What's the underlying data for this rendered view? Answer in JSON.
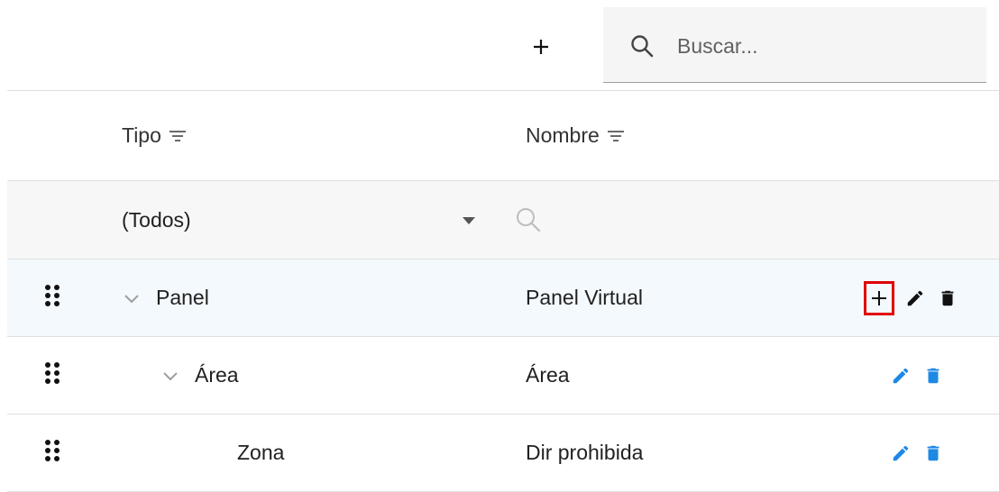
{
  "toolbar": {
    "add_label": "+",
    "search_placeholder": "Buscar..."
  },
  "grid": {
    "columns": [
      {
        "label": "Tipo"
      },
      {
        "label": "Nombre"
      }
    ],
    "filter": {
      "tipo_selected": "(Todos)"
    },
    "rows": [
      {
        "tipo": "Panel",
        "nombre": "Panel Virtual",
        "level": 0,
        "expanded": true
      },
      {
        "tipo": "Área",
        "nombre": "Área",
        "level": 1,
        "expanded": true
      },
      {
        "tipo": "Zona",
        "nombre": "Dir prohibida",
        "level": 2,
        "expanded": false
      }
    ]
  },
  "colors": {
    "accent": "#1e88e5",
    "highlight": "#e00000",
    "dark_icon": "#111111"
  }
}
